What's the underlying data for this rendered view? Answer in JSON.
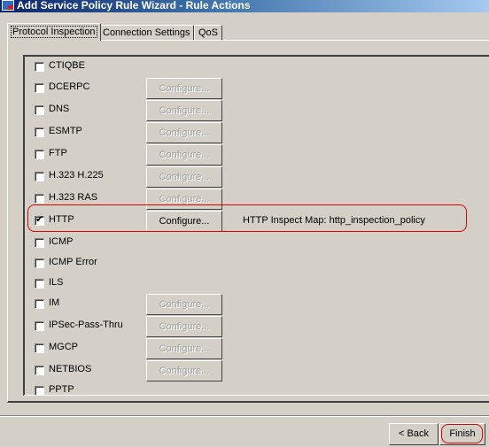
{
  "window": {
    "title": "Add Service Policy Rule Wizard - Rule Actions",
    "icon": "asdm-app-icon"
  },
  "tabs": [
    {
      "label": "Protocol Inspection",
      "active": true
    },
    {
      "label": "Connection Settings",
      "active": false
    },
    {
      "label": "QoS",
      "active": false
    }
  ],
  "inspections": [
    {
      "name": "CTIQBE",
      "checked": false,
      "configure": null
    },
    {
      "name": "DCERPC",
      "checked": false,
      "configure": "Configure..."
    },
    {
      "name": "DNS",
      "checked": false,
      "configure": "Configure..."
    },
    {
      "name": "ESMTP",
      "checked": false,
      "configure": "Configure..."
    },
    {
      "name": "FTP",
      "checked": false,
      "configure": "Configure..."
    },
    {
      "name": "H.323 H.225",
      "checked": false,
      "configure": "Configure..."
    },
    {
      "name": "H.323 RAS",
      "checked": false,
      "configure": "Configure..."
    },
    {
      "name": "HTTP",
      "checked": true,
      "configure": "Configure...",
      "map": "HTTP Inspect Map: http_inspection_policy"
    },
    {
      "name": "ICMP",
      "checked": false,
      "configure": null
    },
    {
      "name": "ICMP Error",
      "checked": false,
      "configure": null
    },
    {
      "name": "ILS",
      "checked": false,
      "configure": null
    },
    {
      "name": "IM",
      "checked": false,
      "configure": "Configure..."
    },
    {
      "name": "IPSec-Pass-Thru",
      "checked": false,
      "configure": "Configure..."
    },
    {
      "name": "MGCP",
      "checked": false,
      "configure": "Configure..."
    },
    {
      "name": "NETBIOS",
      "checked": false,
      "configure": "Configure..."
    },
    {
      "name": "PPTP",
      "checked": false,
      "configure": null
    }
  ],
  "buttons": {
    "back": "< Back",
    "finish": "Finish"
  },
  "colors": {
    "highlight": "#e00000",
    "face": "#d4d0c8"
  }
}
